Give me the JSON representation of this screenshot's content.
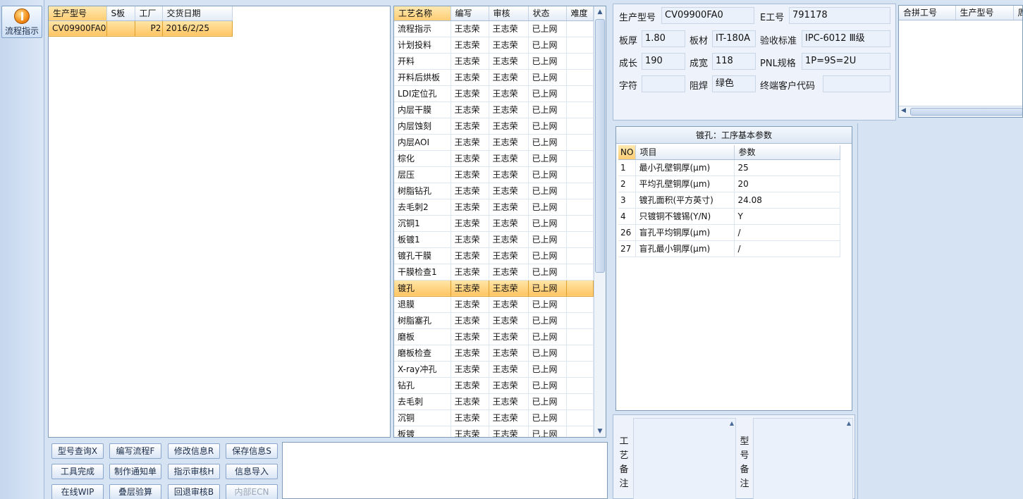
{
  "toolbar": {
    "flow_button_label": "流程指示"
  },
  "part_list": {
    "columns": [
      "生产型号",
      "S板",
      "工厂",
      "交货日期"
    ],
    "rows": [
      {
        "model": "CV09900FA0",
        "s_board": "",
        "factory": "P2",
        "delivery_date": "2016/2/25"
      }
    ]
  },
  "process_list": {
    "columns": [
      "工艺名称",
      "编写",
      "审核",
      "状态",
      "难度"
    ],
    "rows": [
      {
        "name": "流程指示",
        "writer": "王志荣",
        "reviewer": "王志荣",
        "status": "已上网",
        "difficulty": ""
      },
      {
        "name": "计划投料",
        "writer": "王志荣",
        "reviewer": "王志荣",
        "status": "已上网",
        "difficulty": ""
      },
      {
        "name": "开料",
        "writer": "王志荣",
        "reviewer": "王志荣",
        "status": "已上网",
        "difficulty": ""
      },
      {
        "name": "开料后烘板",
        "writer": "王志荣",
        "reviewer": "王志荣",
        "status": "已上网",
        "difficulty": ""
      },
      {
        "name": "LDI定位孔",
        "writer": "王志荣",
        "reviewer": "王志荣",
        "status": "已上网",
        "difficulty": ""
      },
      {
        "name": "内层干膜",
        "writer": "王志荣",
        "reviewer": "王志荣",
        "status": "已上网",
        "difficulty": ""
      },
      {
        "name": "内层蚀刻",
        "writer": "王志荣",
        "reviewer": "王志荣",
        "status": "已上网",
        "difficulty": ""
      },
      {
        "name": "内层AOI",
        "writer": "王志荣",
        "reviewer": "王志荣",
        "status": "已上网",
        "difficulty": ""
      },
      {
        "name": "棕化",
        "writer": "王志荣",
        "reviewer": "王志荣",
        "status": "已上网",
        "difficulty": ""
      },
      {
        "name": "层压",
        "writer": "王志荣",
        "reviewer": "王志荣",
        "status": "已上网",
        "difficulty": ""
      },
      {
        "name": "树脂钻孔",
        "writer": "王志荣",
        "reviewer": "王志荣",
        "status": "已上网",
        "difficulty": ""
      },
      {
        "name": "去毛刺2",
        "writer": "王志荣",
        "reviewer": "王志荣",
        "status": "已上网",
        "difficulty": ""
      },
      {
        "name": "沉铜1",
        "writer": "王志荣",
        "reviewer": "王志荣",
        "status": "已上网",
        "difficulty": ""
      },
      {
        "name": "板镀1",
        "writer": "王志荣",
        "reviewer": "王志荣",
        "status": "已上网",
        "difficulty": ""
      },
      {
        "name": "镀孔干膜",
        "writer": "王志荣",
        "reviewer": "王志荣",
        "status": "已上网",
        "difficulty": ""
      },
      {
        "name": "干膜检查1",
        "writer": "王志荣",
        "reviewer": "王志荣",
        "status": "已上网",
        "difficulty": ""
      },
      {
        "name": "镀孔",
        "writer": "王志荣",
        "reviewer": "王志荣",
        "status": "已上网",
        "difficulty": ""
      },
      {
        "name": "退膜",
        "writer": "王志荣",
        "reviewer": "王志荣",
        "status": "已上网",
        "difficulty": ""
      },
      {
        "name": "树脂塞孔",
        "writer": "王志荣",
        "reviewer": "王志荣",
        "status": "已上网",
        "difficulty": ""
      },
      {
        "name": "磨板",
        "writer": "王志荣",
        "reviewer": "王志荣",
        "status": "已上网",
        "difficulty": ""
      },
      {
        "name": "磨板检查",
        "writer": "王志荣",
        "reviewer": "王志荣",
        "status": "已上网",
        "difficulty": ""
      },
      {
        "name": "X-ray冲孔",
        "writer": "王志荣",
        "reviewer": "王志荣",
        "status": "已上网",
        "difficulty": ""
      },
      {
        "name": "钻孔",
        "writer": "王志荣",
        "reviewer": "王志荣",
        "status": "已上网",
        "difficulty": ""
      },
      {
        "name": "去毛刺",
        "writer": "王志荣",
        "reviewer": "王志荣",
        "status": "已上网",
        "difficulty": ""
      },
      {
        "name": "沉铜",
        "writer": "王志荣",
        "reviewer": "王志荣",
        "status": "已上网",
        "difficulty": ""
      },
      {
        "name": "板镀",
        "writer": "王志荣",
        "reviewer": "王志荣",
        "status": "已上网",
        "difficulty": ""
      }
    ],
    "selected_row": 16
  },
  "actions": {
    "model_query": "型号查询X",
    "write_flow": "编写流程F",
    "modify_info": "修改信息R",
    "save_info": "保存信息S",
    "tool_complete": "工具完成",
    "make_notice": "制作通知单",
    "indication_review": "指示审核H",
    "info_import": "信息导入",
    "online_wip": "在线WIP",
    "stack_check": "叠层验算",
    "return_review": "回退审核B",
    "internal_ecn": "内部ECN"
  },
  "info": {
    "model_label": "生产型号",
    "model_value": "CV09900FA0",
    "e_no_label": "E工号",
    "e_no_value": "791178",
    "thickness_label": "板厚",
    "thickness_value": "1.80",
    "material_label": "板材",
    "material_value": "IT-180A",
    "acceptance_label": "验收标准",
    "acceptance_value": "IPC-6012 Ⅲ级",
    "length_label": "成长",
    "length_value": "190",
    "width_label": "成宽",
    "width_value": "118",
    "pnl_label": "PNL规格",
    "pnl_value": "1P=9S=2U",
    "legend_label": "字符",
    "legend_value": "",
    "mask_label": "阻焊",
    "mask_value": "绿色",
    "customer_label": "终端客户代码",
    "customer_value": ""
  },
  "merged": {
    "columns": [
      "合拼工号",
      "生产型号",
      "周"
    ]
  },
  "params": {
    "title": "镀孔：工序基本参数",
    "columns": [
      "NO",
      "项目",
      "参数"
    ],
    "rows": [
      {
        "no": "1",
        "item": "最小孔壁铜厚(μm)",
        "value": "25"
      },
      {
        "no": "2",
        "item": "平均孔壁铜厚(μm)",
        "value": "20"
      },
      {
        "no": "3",
        "item": "镀孔面积(平方英寸)",
        "value": "24.08"
      },
      {
        "no": "4",
        "item": "只镀铜不镀锡(Y/N)",
        "value": "Y"
      },
      {
        "no": "26",
        "item": "盲孔平均铜厚(μm)",
        "value": "/"
      },
      {
        "no": "27",
        "item": "盲孔最小铜厚(μm)",
        "value": "/"
      }
    ]
  },
  "remarks": {
    "process_remark_label": "工艺备注",
    "model_remark_label": "型号备注"
  },
  "colors": {
    "selection": "#ffc564",
    "background": "#d6e3f3"
  }
}
